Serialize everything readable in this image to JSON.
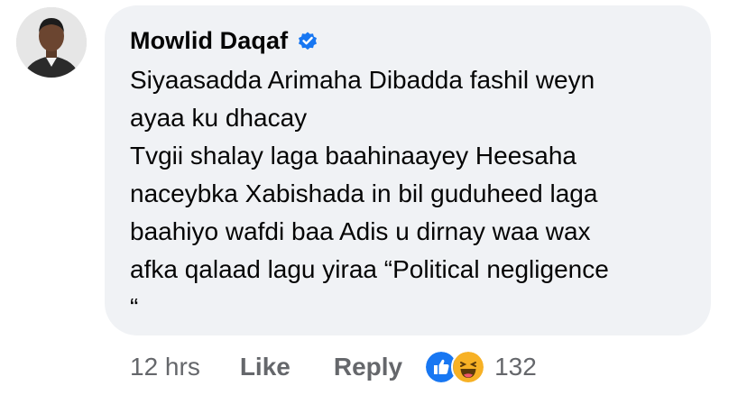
{
  "comment": {
    "author": "Mowlid Daqaf",
    "verified_icon": "verified-badge-icon",
    "text": "Siyaasadda Arimaha Dibadda fashil weyn\nayaa ku dhacay\nTvgii shalay laga baahinaayey Heesaha\nnaceybka Xabishada in bil guduheed laga\nbaahiyo wafdi baa Adis u dirnay waa wax\nafka qalaad lagu yiraa “Political negligence\n“"
  },
  "actions": {
    "time": "12 hrs",
    "like_label": "Like",
    "reply_label": "Reply",
    "reaction_icons": [
      "like-reaction-icon",
      "haha-reaction-icon"
    ],
    "reaction_count": "132"
  },
  "colors": {
    "bubble_bg": "#f0f2f5",
    "verified_blue": "#1877f2",
    "meta_gray": "#65676b"
  }
}
